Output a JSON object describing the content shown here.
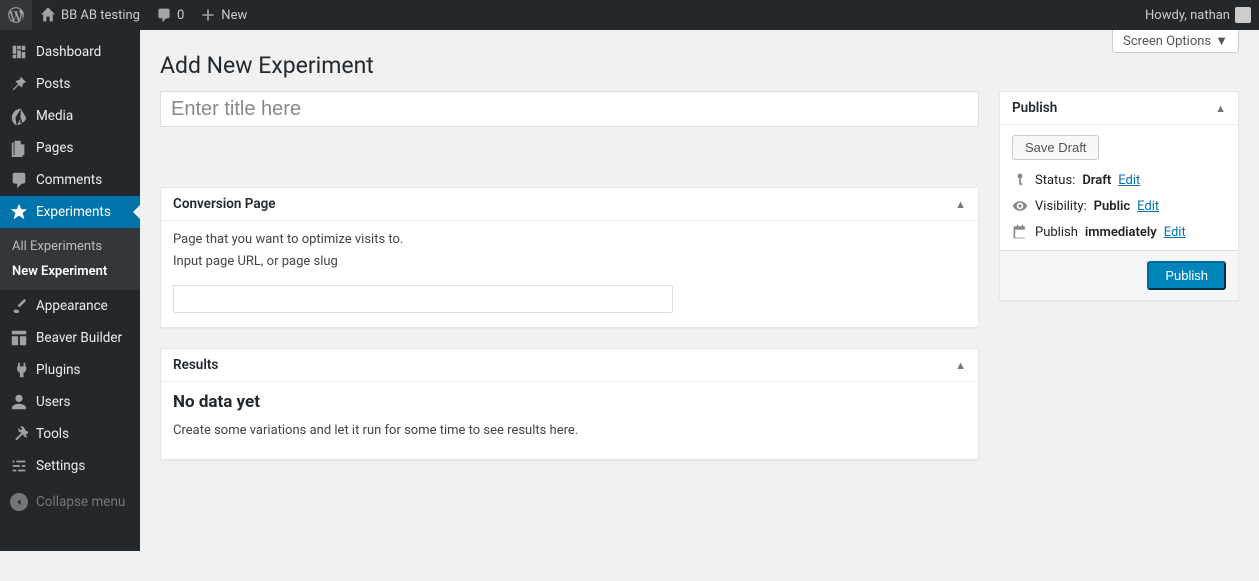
{
  "adminbar": {
    "site_name": "BB AB testing",
    "comments_count": "0",
    "new_label": "New",
    "howdy": "Howdy, nathan"
  },
  "sidebar": {
    "items": [
      {
        "label": "Dashboard"
      },
      {
        "label": "Posts"
      },
      {
        "label": "Media"
      },
      {
        "label": "Pages"
      },
      {
        "label": "Comments"
      },
      {
        "label": "Experiments"
      },
      {
        "label": "Appearance"
      },
      {
        "label": "Beaver Builder"
      },
      {
        "label": "Plugins"
      },
      {
        "label": "Users"
      },
      {
        "label": "Tools"
      },
      {
        "label": "Settings"
      }
    ],
    "submenu": [
      {
        "label": "All Experiments"
      },
      {
        "label": "New Experiment"
      }
    ],
    "collapse_label": "Collapse menu"
  },
  "screen_options_label": "Screen Options",
  "page_title": "Add New Experiment",
  "title_placeholder": "Enter title here",
  "conversion": {
    "heading": "Conversion Page",
    "desc1": "Page that you want to optimize visits to.",
    "desc2": "Input page URL, or page slug"
  },
  "results": {
    "heading": "Results",
    "title": "No data yet",
    "desc": "Create some variations and let it run for some time to see results here."
  },
  "publish": {
    "heading": "Publish",
    "save_draft": "Save Draft",
    "status_label": "Status:",
    "status_value": "Draft",
    "visibility_label": "Visibility:",
    "visibility_value": "Public",
    "schedule_label": "Publish",
    "schedule_value": "immediately",
    "edit": "Edit",
    "publish_button": "Publish"
  }
}
